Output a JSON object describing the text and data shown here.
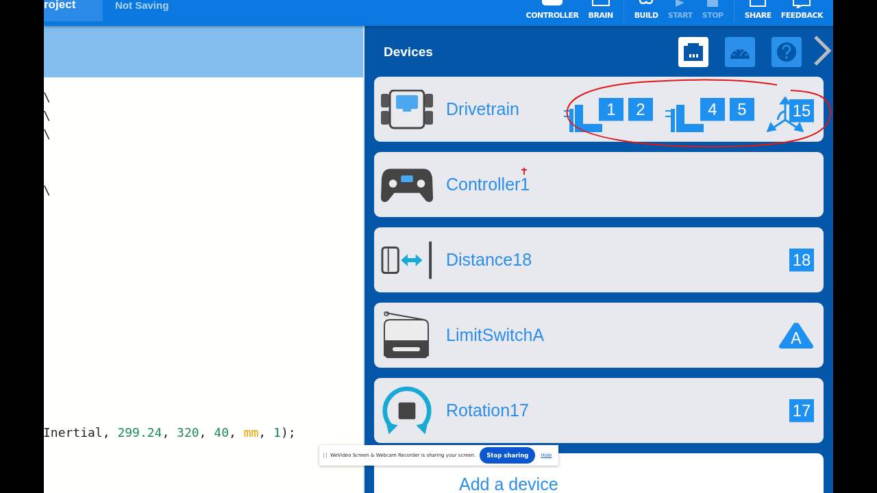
{
  "top_bar": {
    "project_tab": "roject",
    "save_status": "Not Saving",
    "tool_groups": [
      [
        {
          "label": "CONTROLLER",
          "kind": "controller",
          "disabled": false
        },
        {
          "label": "BRAIN",
          "kind": "brain",
          "disabled": false
        }
      ],
      [
        {
          "label": "BUILD",
          "kind": "build",
          "disabled": false
        },
        {
          "label": "START",
          "kind": "start",
          "disabled": true
        },
        {
          "label": "STOP",
          "kind": "stop",
          "disabled": true
        }
      ],
      [
        {
          "label": "SHARE",
          "kind": "share",
          "disabled": false
        },
        {
          "label": "FEEDBACK",
          "kind": "feedback",
          "disabled": false
        }
      ]
    ]
  },
  "editor": {
    "code_blocks": [
      [
        [
          {
            "text": "\\",
            "kind": "plain"
          }
        ],
        [
          {
            "text": "\\",
            "kind": "plain"
          }
        ],
        [
          {
            "text": "\\",
            "kind": "plain"
          }
        ]
      ],
      [
        [
          {
            "text": "\\",
            "kind": "plain"
          }
        ]
      ],
      [
        [
          {
            "text": "Inertial, ",
            "kind": "plain"
          },
          {
            "text": "299.24",
            "kind": "number"
          },
          {
            "text": ", ",
            "kind": "plain"
          },
          {
            "text": "320",
            "kind": "number"
          },
          {
            "text": ", ",
            "kind": "plain"
          },
          {
            "text": "40",
            "kind": "number"
          },
          {
            "text": ", ",
            "kind": "plain"
          },
          {
            "text": "mm",
            "kind": "unit"
          },
          {
            "text": ", ",
            "kind": "plain"
          },
          {
            "text": "1",
            "kind": "number"
          },
          {
            "text": ");",
            "kind": "plain"
          }
        ]
      ]
    ]
  },
  "devices_panel": {
    "title": "Devices",
    "header_buttons": [
      {
        "kind": "ports",
        "selected": true
      },
      {
        "kind": "dashboard",
        "selected": false
      },
      {
        "kind": "help",
        "selected": false
      }
    ],
    "devices": [
      {
        "name": "Drivetrain",
        "kind": "drivetrain",
        "annotated": true,
        "ports": [
          {
            "kind": "motor_group",
            "labels": [
              "1",
              "2"
            ]
          },
          {
            "kind": "motor_group",
            "labels": [
              "4",
              "5"
            ]
          },
          {
            "kind": "inertial",
            "labels": [
              "15"
            ]
          }
        ]
      },
      {
        "name": "Controller1",
        "kind": "controller",
        "annotated": false
      },
      {
        "name": "Distance18",
        "kind": "distance",
        "annotated": false,
        "ports": [
          {
            "kind": "port",
            "labels": [
              "18"
            ]
          }
        ]
      },
      {
        "name": "LimitSwitchA",
        "kind": "limit_switch",
        "annotated": false,
        "ports": [
          {
            "kind": "triport",
            "labels": [
              "A"
            ]
          }
        ]
      },
      {
        "name": "Rotation17",
        "kind": "rotation",
        "annotated": false,
        "ports": [
          {
            "kind": "port",
            "labels": [
              "17"
            ]
          }
        ]
      }
    ],
    "add_device": "Add a device"
  },
  "share_notice": {
    "text": "WeVideo Screen & Webcam Recorder is sharing your screen.",
    "button": "Stop sharing",
    "link": "Hide"
  }
}
